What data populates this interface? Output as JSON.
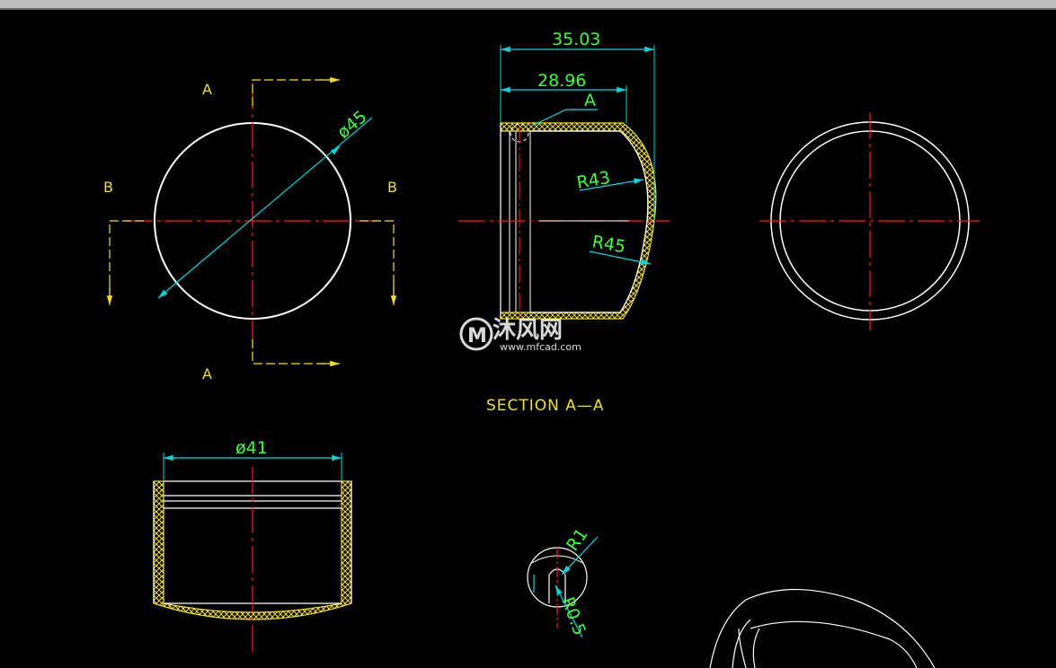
{
  "drawing": {
    "dimensions": {
      "dia45": "ø45",
      "len35": "35.03",
      "len28": "28.96",
      "r43": "R43",
      "r45": "R45",
      "dia41": "ø41",
      "r1": "R1",
      "r05": "R0.5"
    },
    "labels": {
      "a_top": "A",
      "a_bottom": "A",
      "b_left": "B",
      "b_right": "B",
      "a_leader": "A",
      "section": "SECTION  A—A"
    },
    "watermark": {
      "brand": "沐风网",
      "url": "www.mfcad.com"
    },
    "colors": {
      "background": "#000000",
      "outline": "#ffffff",
      "dimension": "#00d8e0",
      "dimension_text": "#39ff3a",
      "centerline": "#ff1a1a",
      "section_line": "#f2e01c",
      "hatch": "#f2e01c"
    }
  }
}
